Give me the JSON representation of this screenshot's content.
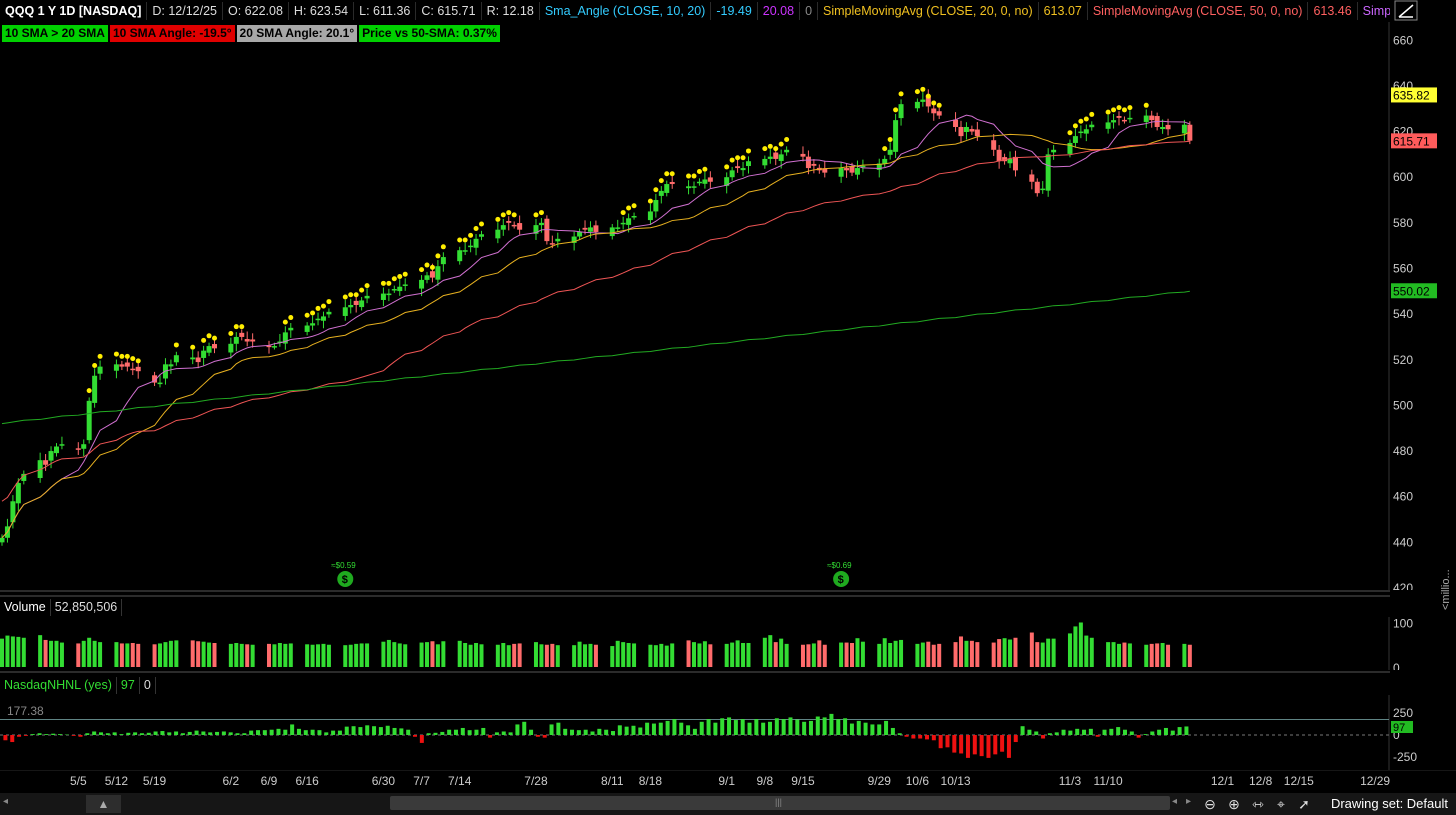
{
  "header": {
    "symbol": "QQQ 1 Y 1D [NASDAQ]",
    "date": "D: 12/12/25",
    "open": "O: 622.08",
    "high": "H: 623.54",
    "low": "L: 611.36",
    "close": "C: 615.71",
    "range": "R: 12.18",
    "sma_angle_study": "Sma_Angle (CLOSE, 10, 20)",
    "sma_angle_v1": "-19.49",
    "sma_angle_v2": "20.08",
    "sma_angle_v3": "0",
    "sma20_study": "SimpleMovingAvg (CLOSE, 20, 0, no)",
    "sma20_value": "613.07",
    "sma50_study": "SimpleMovingAvg (CLOSE, 50, 0, no)",
    "sma50_value": "613.46",
    "more_study": "Simple..."
  },
  "badges": [
    {
      "label": "10 SMA > 20 SMA",
      "color": "#00d000"
    },
    {
      "label": "10 SMA Angle: -19.5°",
      "color": "#e00000"
    },
    {
      "label": "20 SMA Angle: 20.1°",
      "color": "#a8a8a8"
    },
    {
      "label": "Price vs 50-SMA: 0.37%",
      "color": "#00d000"
    }
  ],
  "price_tags": [
    {
      "label": "635.82",
      "value": 635.82,
      "color": "#ffff33",
      "text": "#000"
    },
    {
      "label": "615.71",
      "value": 615.71,
      "color": "#ff5b5b",
      "text": "#000"
    },
    {
      "label": "550.02",
      "value": 550.02,
      "color": "#22bb22",
      "text": "#000"
    }
  ],
  "dividends": [
    {
      "label": "≈$0.59",
      "date": "6/23"
    },
    {
      "label": "≈$0.69",
      "date": "9/22"
    }
  ],
  "volume_pane": {
    "label": "Volume",
    "value": "52,850,506",
    "axis": [
      "100",
      "0"
    ],
    "unit": "<millio..."
  },
  "nhnl_pane": {
    "label": "NasdaqNHNL (yes)",
    "v1": "97",
    "v2": "0",
    "ref": "177.38",
    "axis": [
      "250",
      "0",
      "-250"
    ],
    "tag": "97"
  },
  "bottom": {
    "drawing_set": "Drawing set: Default"
  },
  "colors": {
    "up": "#33dd33",
    "down": "#ff6b6b",
    "sma10": "#d070d0",
    "sma20": "#e6b020",
    "sma50": "#ee5555",
    "sma200": "#22aa22",
    "dot": "#ffee00"
  },
  "chart_data": {
    "type": "candlestick",
    "title": "QQQ 1 Y 1D [NASDAQ]",
    "ylim": [
      420,
      668
    ],
    "yticks": [
      420,
      440,
      460,
      480,
      500,
      520,
      540,
      560,
      580,
      600,
      620,
      640,
      660
    ],
    "xlabels": [
      "5/5",
      "5/12",
      "5/19",
      "6/2",
      "6/9",
      "6/16",
      "6/30",
      "7/7",
      "7/14",
      "7/28",
      "8/11",
      "8/18",
      "9/1",
      "9/8",
      "9/15",
      "9/29",
      "10/6",
      "10/13",
      "11/3",
      "11/10",
      "12/1",
      "12/8",
      "12/15",
      "12/29"
    ],
    "xlabel_dates": [
      "2025-05-05",
      "2025-05-12",
      "2025-05-19",
      "2025-06-02",
      "2025-06-09",
      "2025-06-16",
      "2025-06-30",
      "2025-07-07",
      "2025-07-14",
      "2025-07-28",
      "2025-08-11",
      "2025-08-18",
      "2025-09-01",
      "2025-09-08",
      "2025-09-15",
      "2025-09-29",
      "2025-10-06",
      "2025-10-13",
      "2025-11-03",
      "2025-11-10",
      "2025-12-01",
      "2025-12-08",
      "2025-12-15",
      "2025-12-29"
    ],
    "start_date": "2025-04-21",
    "end_date": "2025-12-31",
    "closes": [
      442,
      447,
      458,
      466,
      470,
      476,
      474,
      480,
      482,
      483,
      481,
      483,
      502,
      513,
      517,
      518,
      517,
      517,
      516,
      515,
      510,
      510,
      518,
      518,
      522,
      521,
      519,
      524,
      526,
      525,
      527,
      530,
      530,
      528,
      528,
      526,
      526,
      528,
      532,
      534,
      535,
      536,
      538,
      539,
      541,
      543,
      544,
      544,
      546,
      548,
      549,
      549,
      551,
      552,
      553,
      555,
      557,
      556,
      561,
      565,
      568,
      568,
      570,
      573,
      575,
      577,
      579,
      580,
      579,
      577,
      579,
      580,
      572,
      571,
      573,
      574,
      576,
      577,
      578,
      576,
      578,
      578,
      580,
      582,
      583,
      585,
      590,
      594,
      597,
      597,
      596,
      596,
      598,
      599,
      598,
      600,
      603,
      604,
      604,
      607,
      608,
      609,
      608,
      610,
      612,
      609,
      604,
      605,
      603,
      602,
      604,
      603,
      602,
      604,
      605,
      606,
      608,
      612,
      625,
      632,
      633,
      634,
      631,
      628,
      627,
      622,
      618,
      622,
      620,
      618,
      612,
      607,
      607,
      608,
      603,
      598,
      593,
      595,
      610,
      612,
      615,
      618,
      620,
      621,
      623,
      624,
      625,
      626,
      625,
      626,
      627,
      625,
      622,
      622,
      621,
      623,
      616
    ],
    "sma200_start": 492,
    "sma200_end": 550.02,
    "volume": [
      65,
      72,
      70,
      69,
      67,
      73,
      62,
      60,
      60,
      56,
      54,
      60,
      67,
      60,
      57,
      57,
      54,
      54,
      55,
      53,
      52,
      54,
      57,
      60,
      61,
      61,
      59,
      58,
      56,
      55,
      53,
      55,
      53,
      52,
      51,
      53,
      52,
      55,
      53,
      54,
      52,
      51,
      52,
      53,
      51,
      50,
      51,
      53,
      54,
      54,
      58,
      62,
      57,
      54,
      52,
      56,
      57,
      59,
      52,
      59,
      60,
      55,
      51,
      55,
      52,
      51,
      55,
      50,
      53,
      54,
      57,
      52,
      51,
      53,
      50,
      50,
      58,
      52,
      53,
      51,
      48,
      60,
      57,
      55,
      54,
      51,
      50,
      53,
      49,
      54,
      61,
      57,
      54,
      59,
      52,
      53,
      56,
      61,
      55,
      55,
      67,
      73,
      57,
      65,
      53,
      51,
      52,
      54,
      61,
      51,
      56,
      56,
      55,
      66,
      58,
      53,
      66,
      55,
      60,
      62,
      53,
      56,
      58,
      51,
      53,
      57,
      70,
      60,
      60,
      57,
      56,
      64,
      66,
      63,
      67,
      79,
      57,
      56,
      65,
      65,
      77,
      93,
      102,
      72,
      67,
      57,
      57,
      53,
      56,
      54,
      51,
      53,
      54,
      55,
      51,
      53,
      51
    ],
    "nhnl": [
      -60,
      -80,
      -20,
      -10,
      10,
      20,
      10,
      15,
      10,
      5,
      -10,
      -20,
      20,
      40,
      30,
      20,
      30,
      10,
      25,
      30,
      20,
      25,
      40,
      45,
      30,
      40,
      20,
      35,
      50,
      40,
      30,
      35,
      40,
      30,
      20,
      20,
      50,
      55,
      55,
      60,
      70,
      60,
      120,
      70,
      55,
      60,
      55,
      30,
      50,
      50,
      95,
      100,
      90,
      110,
      100,
      90,
      105,
      80,
      75,
      60,
      -20,
      -90,
      20,
      25,
      35,
      60,
      60,
      80,
      55,
      60,
      80,
      -30,
      30,
      40,
      30,
      120,
      150,
      60,
      -20,
      -30,
      120,
      140,
      70,
      60,
      55,
      60,
      40,
      70,
      60,
      45,
      110,
      95,
      105,
      85,
      140,
      130,
      140,
      160,
      180,
      140,
      110,
      70,
      150,
      180,
      140,
      190,
      200,
      170,
      180,
      140,
      180,
      140,
      150,
      190,
      180,
      200,
      175,
      150,
      160,
      210,
      200,
      240,
      180,
      190,
      130,
      160,
      140,
      120,
      120,
      160,
      80,
      20,
      -20,
      -40,
      -40,
      -50,
      -60,
      -150,
      -140,
      -200,
      -210,
      -260,
      -220,
      -240,
      -260,
      -220,
      -190,
      -260,
      -80,
      100,
      60,
      40,
      -40,
      20,
      30,
      60,
      50,
      70,
      60,
      70,
      -20,
      60,
      70,
      90,
      60,
      40,
      -30,
      10,
      40,
      60,
      80,
      50,
      90,
      97
    ]
  }
}
